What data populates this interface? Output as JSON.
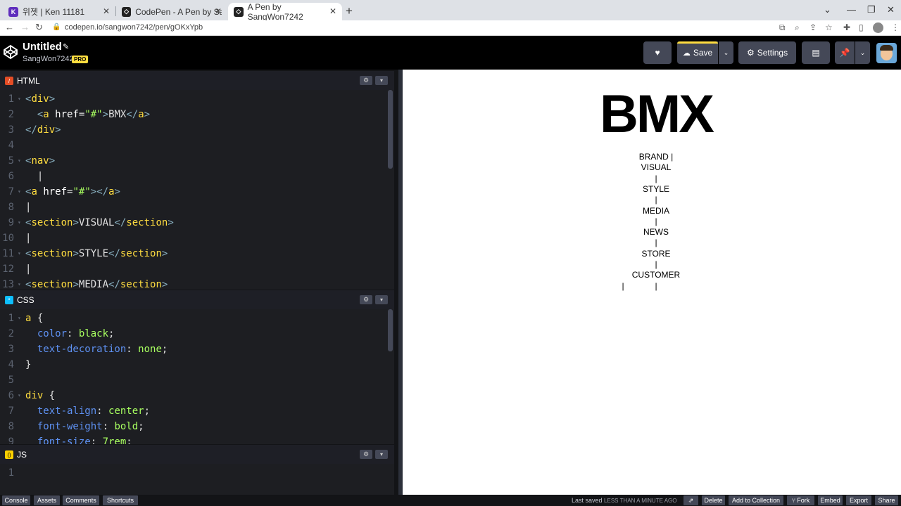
{
  "browser": {
    "tabs": [
      {
        "title": "위젯 | Ken 11181",
        "favicon": "K",
        "color": "#5f2ebd",
        "active": false
      },
      {
        "title": "CodePen - A Pen by SangWon7",
        "favicon": "C",
        "color": "#222222",
        "active": false
      },
      {
        "title": "A Pen by SangWon7242",
        "favicon": "C",
        "color": "#222222",
        "active": true
      }
    ],
    "url": "codepen.io/sangwon7242/pen/gOKxYpb",
    "new_tab": "+"
  },
  "codepen": {
    "title": "Untitled",
    "user": "SangWon7242",
    "pro": "PRO",
    "save_label": "Save",
    "settings_label": "Settings"
  },
  "editors": {
    "html": {
      "label": "HTML",
      "lines": [
        {
          "n": "1",
          "code": "<div>"
        },
        {
          "n": "2",
          "code": "  <a href=\"#\">BMX</a>"
        },
        {
          "n": "3",
          "code": "</div>"
        },
        {
          "n": "4",
          "code": ""
        },
        {
          "n": "5",
          "code": "<nav>"
        },
        {
          "n": "6",
          "code": "  |"
        },
        {
          "n": "7",
          "code": "<a href=\"#\"></a>"
        },
        {
          "n": "8",
          "code": "|"
        },
        {
          "n": "9",
          "code": "<section>VISUAL</section>"
        },
        {
          "n": "10",
          "code": "|"
        },
        {
          "n": "11",
          "code": "<section>STYLE</section>"
        },
        {
          "n": "12",
          "code": "|"
        },
        {
          "n": "13",
          "code": "<section>MEDIA</section>"
        }
      ]
    },
    "css": {
      "label": "CSS",
      "lines": [
        {
          "n": "1",
          "code": "a {"
        },
        {
          "n": "2",
          "code": "  color: black;"
        },
        {
          "n": "3",
          "code": "  text-decoration: none;"
        },
        {
          "n": "4",
          "code": "}"
        },
        {
          "n": "5",
          "code": ""
        },
        {
          "n": "6",
          "code": "div {"
        },
        {
          "n": "7",
          "code": "  text-align: center;"
        },
        {
          "n": "8",
          "code": "  font-weight: bold;"
        },
        {
          "n": "9",
          "code": "  font-size: 7rem;"
        }
      ]
    },
    "js": {
      "label": "JS",
      "lines": [
        {
          "n": "1",
          "code": ""
        }
      ]
    }
  },
  "preview": {
    "heading": "BMX",
    "nav": [
      "BRAND |",
      "VISUAL",
      "|",
      "STYLE",
      "|",
      "MEDIA",
      "|",
      "NEWS",
      "|",
      "STORE",
      "|",
      "CUSTOMER"
    ],
    "last_bars": "|"
  },
  "footer": {
    "left": [
      "Console",
      "Assets",
      "Comments",
      "Shortcuts"
    ],
    "saved_label": "Last saved",
    "saved_ago": "LESS THAN A MINUTE AGO",
    "right": [
      "Delete",
      "Add to Collection",
      "Fork",
      "Embed",
      "Export",
      "Share"
    ]
  }
}
